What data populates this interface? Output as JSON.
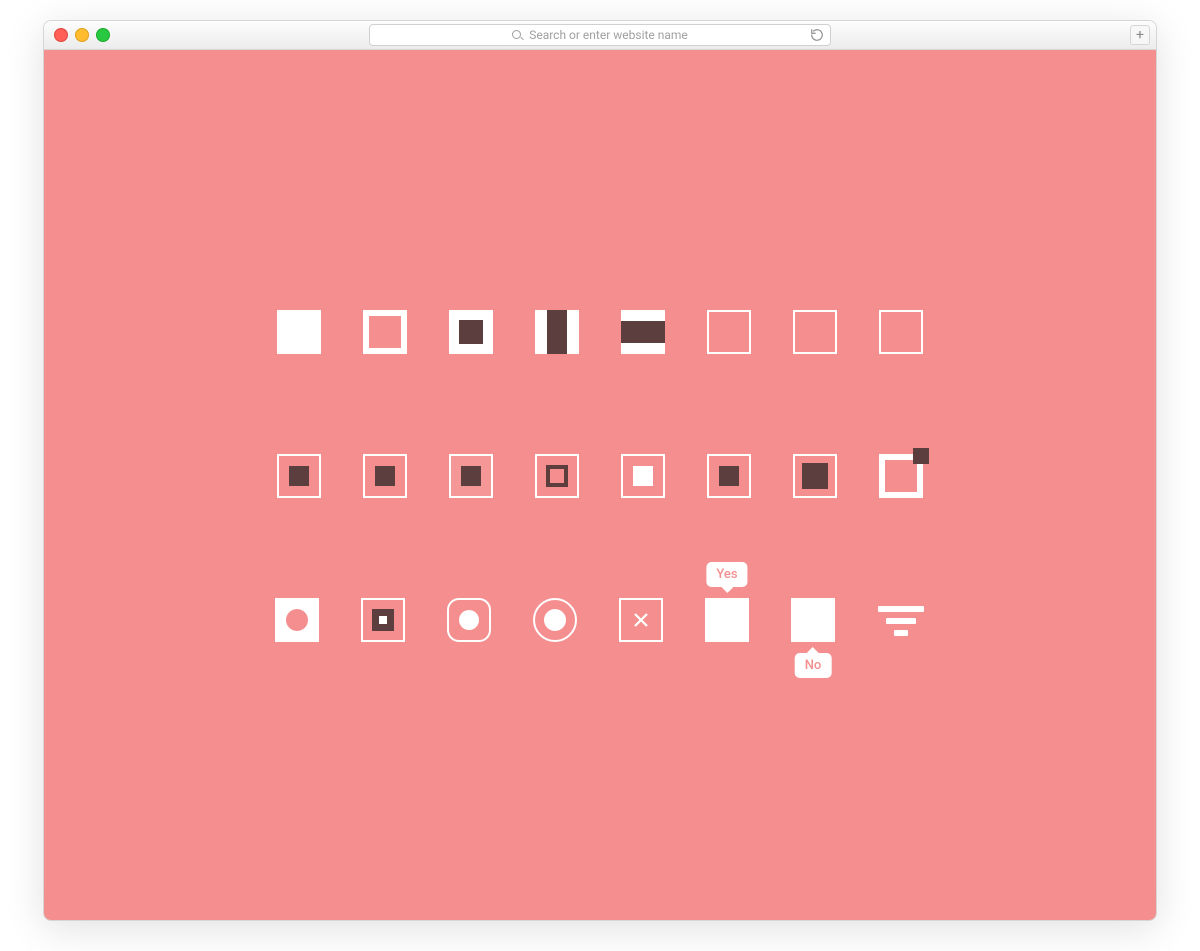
{
  "browser": {
    "address_placeholder": "Search or enter website name",
    "newtab_label": "+"
  },
  "checkboxes": {
    "row1": [
      {
        "id": "cb-solid"
      },
      {
        "id": "cb-thick-outline"
      },
      {
        "id": "cb-dark-fill"
      },
      {
        "id": "cb-vertical-slide"
      },
      {
        "id": "cb-horizontal-slide"
      },
      {
        "id": "cb-outline-1"
      },
      {
        "id": "cb-outline-2"
      },
      {
        "id": "cb-outline-3"
      }
    ],
    "row2": [
      {
        "id": "cb-outline-dark-1"
      },
      {
        "id": "cb-outline-dark-2"
      },
      {
        "id": "cb-outline-dark-3"
      },
      {
        "id": "cb-nested-outline"
      },
      {
        "id": "cb-outline-white-inner"
      },
      {
        "id": "cb-outline-dark-4"
      },
      {
        "id": "cb-outline-dark-large"
      },
      {
        "id": "cb-corner-pip"
      }
    ],
    "row3": [
      {
        "id": "cb-circle-cutout"
      },
      {
        "id": "cb-nested-square"
      },
      {
        "id": "cb-rounded-circle"
      },
      {
        "id": "cb-circle-in-ring"
      },
      {
        "id": "cb-x-mark"
      },
      {
        "id": "cb-tooltip-yes",
        "tooltip_top": "Yes"
      },
      {
        "id": "cb-tooltip-no",
        "tooltip_bottom": "No"
      },
      {
        "id": "cb-filter-lines"
      }
    ]
  }
}
